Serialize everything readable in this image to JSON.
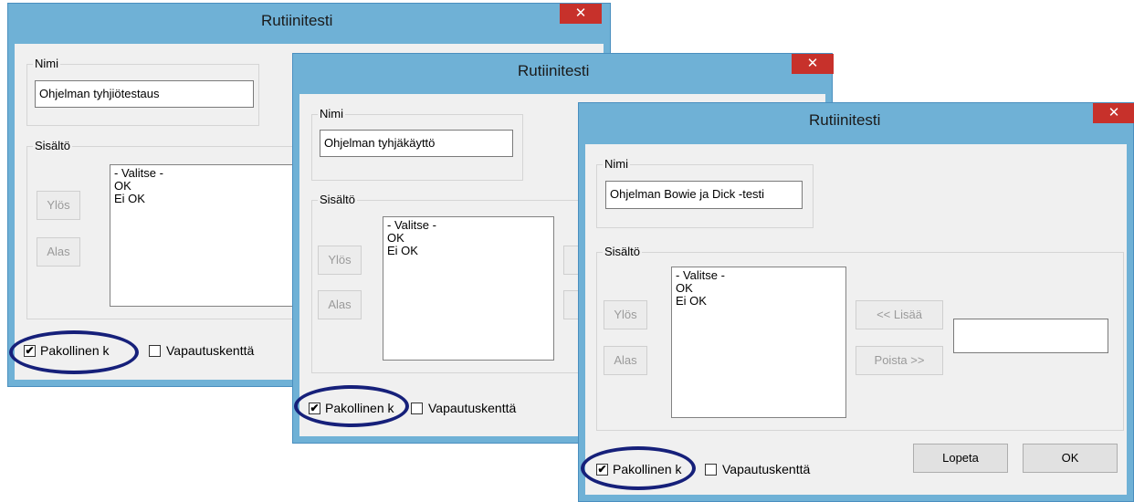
{
  "dialogs": [
    {
      "title": "Rutiinitesti",
      "close_glyph": "✕",
      "name_group_label": "Nimi",
      "name_value": "Ohjelman tyhjiötestaus",
      "content_group_label": "Sisältö",
      "list_items": [
        "- Valitse -",
        "OK",
        "Ei OK"
      ],
      "up_label": "Ylös",
      "down_label": "Alas",
      "mandatory_label": "Pakollinen k",
      "mandatory_checked": true,
      "exemption_label": "Vapautuskenttä",
      "exemption_checked": false
    },
    {
      "title": "Rutiinitesti",
      "close_glyph": "✕",
      "name_group_label": "Nimi",
      "name_value": "Ohjelman tyhjäkäyttö",
      "content_group_label": "Sisältö",
      "list_items": [
        "- Valitse -",
        "OK",
        "Ei OK"
      ],
      "up_label": "Ylös",
      "down_label": "Alas",
      "mandatory_label": "Pakollinen k",
      "mandatory_checked": true,
      "exemption_label": "Vapautuskenttä",
      "exemption_checked": false
    },
    {
      "title": "Rutiinitesti",
      "close_glyph": "✕",
      "name_group_label": "Nimi",
      "name_value": "Ohjelman Bowie ja Dick -testi",
      "content_group_label": "Sisältö",
      "list_items": [
        "- Valitse -",
        "OK",
        "Ei OK"
      ],
      "up_label": "Ylös",
      "down_label": "Alas",
      "add_label": "<< Lisää",
      "remove_label": "Poista >>",
      "new_item_value": "",
      "mandatory_label": "Pakollinen k",
      "mandatory_checked": true,
      "exemption_label": "Vapautuskenttä",
      "exemption_checked": false,
      "cancel_label": "Lopeta",
      "ok_label": "OK"
    }
  ],
  "colors": {
    "window_frame": "#6fb1d6",
    "close_button": "#c7312b",
    "highlight_oval": "#16207a"
  }
}
